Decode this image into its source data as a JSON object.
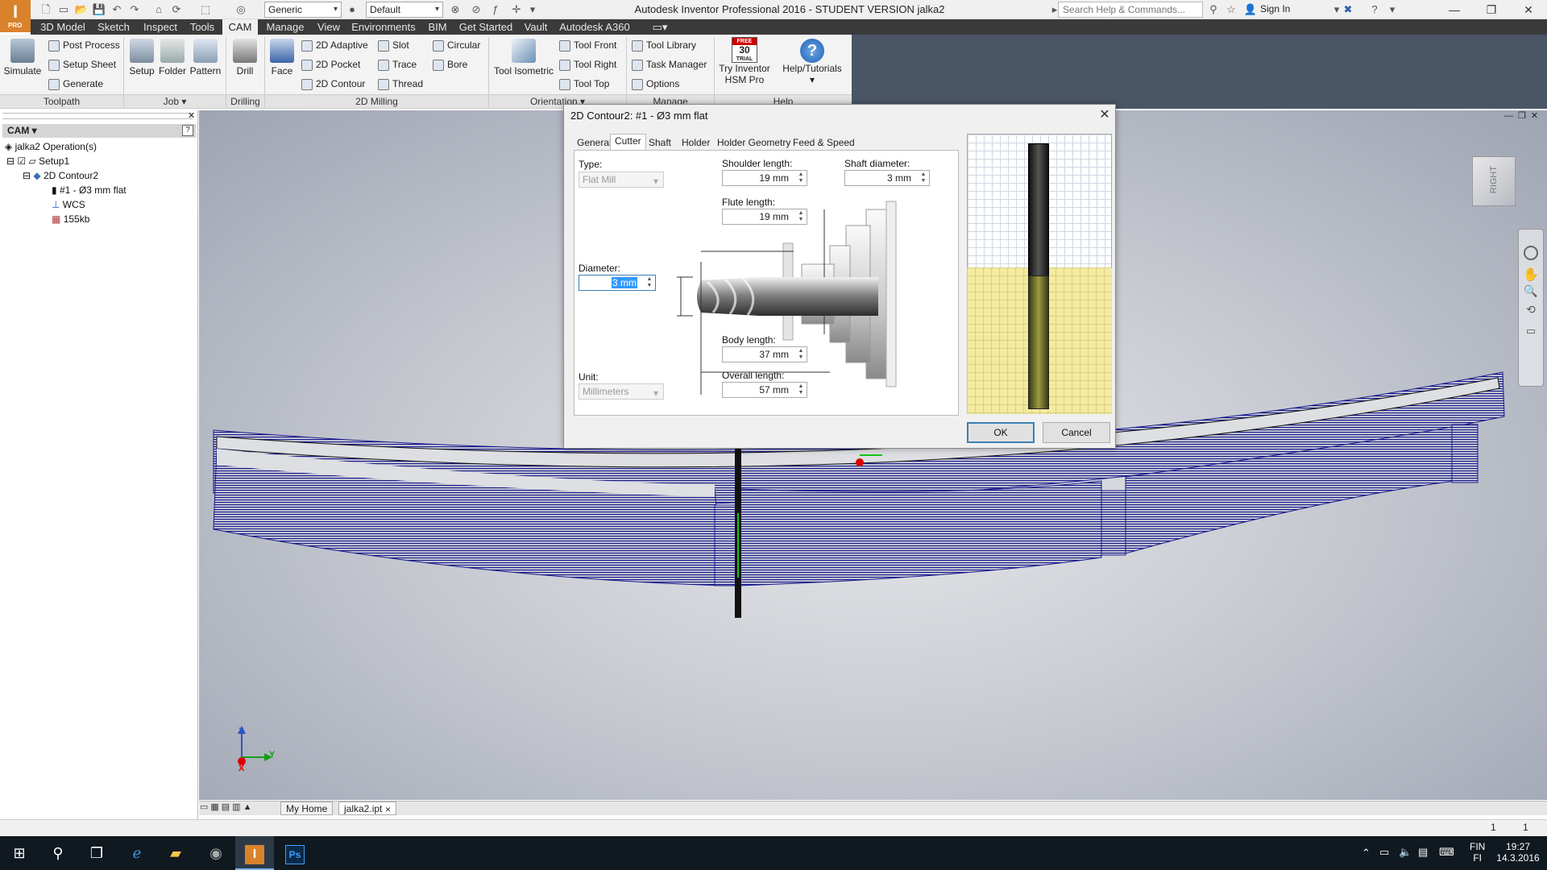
{
  "app": {
    "logo": "I",
    "logo_sub": "PRO",
    "title": "Autodesk Inventor Professional 2016 - STUDENT VERSION   jalka2",
    "material_combo": "Generic",
    "appearance_combo": "Default",
    "search_placeholder": "Search Help & Commands...",
    "sign_in": "Sign In"
  },
  "menu_tabs": [
    "3D Model",
    "Sketch",
    "Inspect",
    "Tools",
    "CAM",
    "Manage",
    "View",
    "Environments",
    "BIM",
    "Get Started",
    "Vault",
    "Autodesk A360"
  ],
  "active_tab": "CAM",
  "ribbon": {
    "toolpath": {
      "simulate": "Simulate",
      "post_process": "Post Process",
      "setup_sheet": "Setup Sheet",
      "generate": "Generate",
      "panel": "Toolpath"
    },
    "job": {
      "setup": "Setup",
      "folder": "Folder",
      "pattern": "Pattern",
      "panel": "Job"
    },
    "drilling": {
      "drill": "Drill",
      "panel": "Drilling"
    },
    "milling_2d": {
      "face": "Face",
      "adaptive": "2D Adaptive",
      "pocket": "2D Pocket",
      "contour": "2D Contour",
      "slot": "Slot",
      "trace": "Trace",
      "thread": "Thread",
      "circular": "Circular",
      "bore": "Bore",
      "panel": "2D Milling"
    },
    "orientation": {
      "isometric": "Tool Isometric",
      "front": "Tool Front",
      "right": "Tool Right",
      "top": "Tool Top",
      "panel": "Orientation"
    },
    "manage": {
      "library": "Tool Library",
      "task_manager": "Task Manager",
      "options": "Options",
      "panel": "Manage"
    },
    "help": {
      "try_line1": "Try Inventor",
      "try_line2": "HSM Pro",
      "tutorials": "Help/Tutorials",
      "panel": "Help",
      "free_badge_top": "FREE",
      "free_badge_num": "30",
      "free_badge_bottom": "TRIAL"
    }
  },
  "browser": {
    "header": "CAM",
    "items": [
      "jalka2 Operation(s)",
      "Setup1",
      "2D Contour2",
      "#1 - Ø3 mm flat",
      "WCS",
      "155kb"
    ]
  },
  "dialog": {
    "title": "2D Contour2: #1 - Ø3 mm flat",
    "tabs": [
      "General",
      "Cutter",
      "Shaft",
      "Holder",
      "Holder Geometry",
      "Feed & Speed"
    ],
    "active_tab": "Cutter",
    "type_label": "Type:",
    "type_value": "Flat Mill",
    "diameter_label": "Diameter:",
    "diameter_value": "3 mm",
    "unit_label": "Unit:",
    "unit_value": "Millimeters",
    "shoulder_label": "Shoulder length:",
    "shoulder_value": "19 mm",
    "shaft_label": "Shaft diameter:",
    "shaft_value": "3 mm",
    "flute_label": "Flute length:",
    "flute_value": "19 mm",
    "body_label": "Body length:",
    "body_value": "37 mm",
    "overall_label": "Overall length:",
    "overall_value": "57 mm",
    "ok": "OK",
    "cancel": "Cancel"
  },
  "viewcube_face": "RIGHT",
  "axis": {
    "z": "Z",
    "y": "Y",
    "x": "X"
  },
  "doc_tabs": [
    "My Home",
    "jalka2.ipt"
  ],
  "status": {
    "left_count": "1",
    "right_count": "1"
  },
  "taskbar": {
    "lang_top": "FIN",
    "lang_bottom": "FI",
    "time": "19:27",
    "date": "14.3.2016"
  },
  "colors": {
    "accent": "#3c7fb1",
    "ribbon_dark": "#3a3a3a",
    "toolpath": "#1a1a8c",
    "material": "#f4ea9a"
  }
}
